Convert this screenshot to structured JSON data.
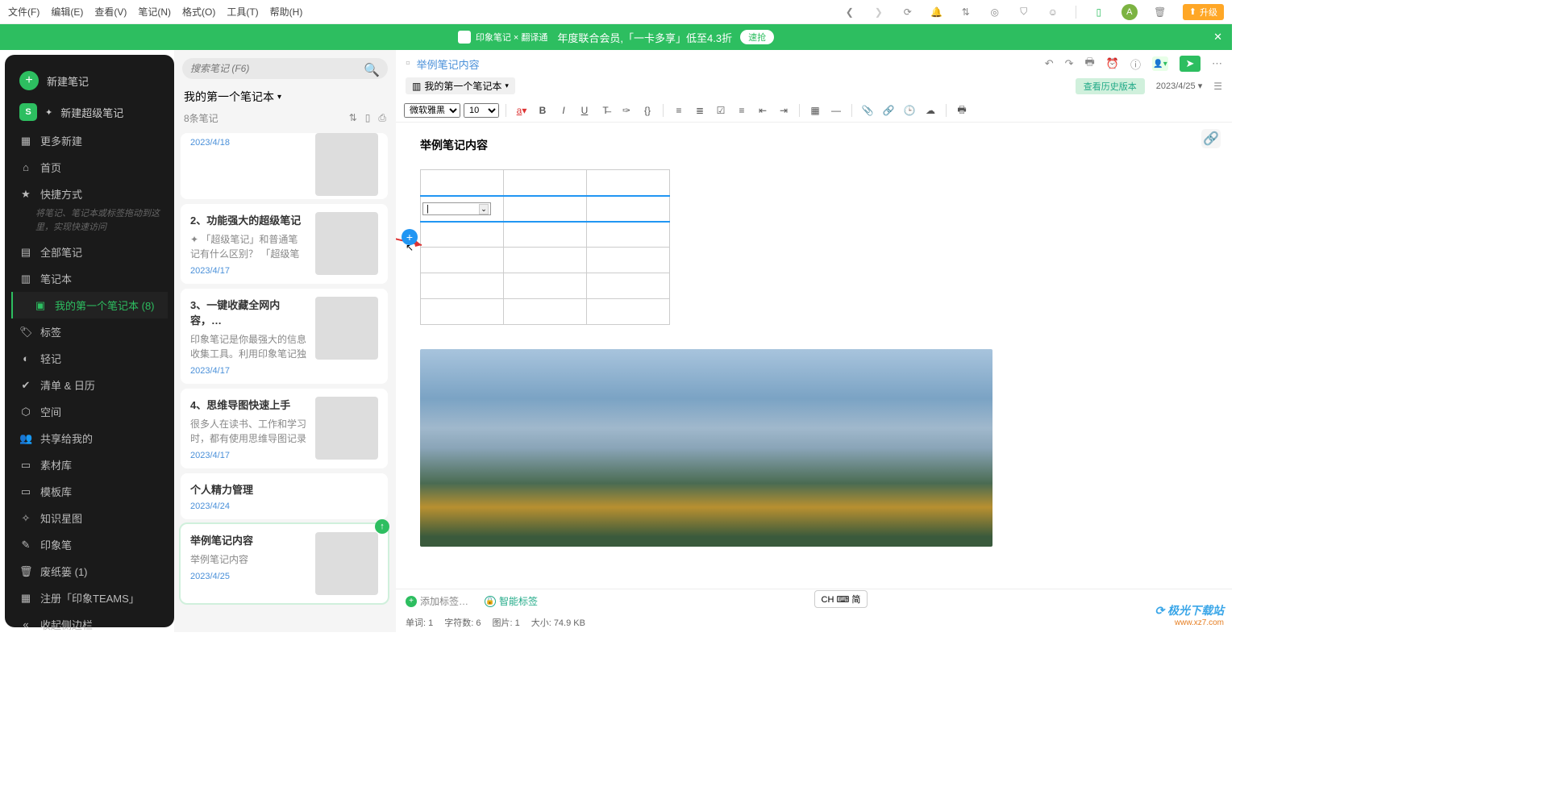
{
  "menu": {
    "items": [
      "文件(F)",
      "编辑(E)",
      "查看(V)",
      "笔记(N)",
      "格式(O)",
      "工具(T)",
      "帮助(H)"
    ],
    "avatar": "A",
    "upgrade": "升级"
  },
  "banner": {
    "brand": "印象笔记 × 翻译通",
    "text": "年度联合会员,「一卡多享」低至4.3折",
    "action": "速抢"
  },
  "sidebar": {
    "newNote": "新建笔记",
    "newSuper": "新建超级笔记",
    "moreNew": "更多新建",
    "home": "首页",
    "shortcut": "快捷方式",
    "shortcutHint": "将笔记、笔记本或标签拖动到这里，实现快速访问",
    "allNotes": "全部笔记",
    "notebooks": "笔记本",
    "myNotebook": "我的第一个笔记本  (8)",
    "tags": "标签",
    "light": "轻记",
    "tasks": "清单 & 日历",
    "space": "空间",
    "shared": "共享给我的",
    "material": "素材库",
    "template": "模板库",
    "knowledge": "知识星图",
    "pen": "印象笔",
    "trash": "废纸篓  (1)",
    "teams": "注册「印象TEAMS」",
    "collapse": "收起侧边栏"
  },
  "notelist": {
    "searchPlaceholder": "搜索笔记 (F6)",
    "notebook": "我的第一个笔记本",
    "count": "8条笔记",
    "cards": [
      {
        "title": "",
        "snippet": "",
        "date": "2023/4/18",
        "thumb": "thumb-0",
        "truncated": true
      },
      {
        "title": "2、功能强大的超级笔记",
        "snippet": "✦ 「超级笔记」和普通笔记有什么区别？ 「超级笔记」将各种…",
        "date": "2023/4/17",
        "thumb": "thumb-a"
      },
      {
        "title": "3、一键收藏全网内容，…",
        "snippet": "印象笔记是你最强大的信息收集工具。利用印象笔记独家的剪…",
        "date": "2023/4/17",
        "thumb": "thumb-c"
      },
      {
        "title": "4、思维导图快速上手",
        "snippet": "很多人在读书、工作和学习时，都有使用思维导图记录要点、…",
        "date": "2023/4/17",
        "thumb": "thumb-d"
      },
      {
        "title": "个人精力管理",
        "snippet": "",
        "date": "2023/4/24",
        "thumb": ""
      },
      {
        "title": "举例笔记内容",
        "snippet": "举例笔记内容",
        "date": "2023/4/25",
        "thumb": "thumb-e",
        "selected": true,
        "sync": true
      }
    ]
  },
  "editor": {
    "title": "举例笔记内容",
    "notebook": "我的第一个笔记本",
    "history": "查看历史版本",
    "date": "2023/4/25",
    "font": "微软雅黑",
    "size": "10",
    "heading": "举例笔记内容",
    "addTag": "添加标签…",
    "smartTag": "智能标签",
    "status": {
      "words": "单词:  1",
      "chars": "字符数:  6",
      "images": "图片:  1",
      "size": "大小:  74.9 KB"
    },
    "ime": "CH ⌨ 简"
  },
  "watermark": {
    "l1": "极光下载站",
    "l2": "www.xz7.com"
  }
}
